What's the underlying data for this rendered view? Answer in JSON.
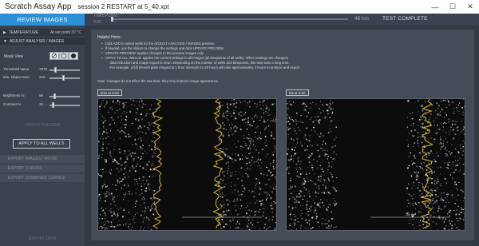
{
  "window": {
    "app_title": "Scratch Assay App",
    "session_title": "session 2 RESTART at 5_40.xpt",
    "minimize_glyph": "—",
    "maximize_glyph": "☐",
    "close_glyph": "✕"
  },
  "topbar": {
    "review_label": "REVIEW IMAGES",
    "timepoint_label": "TIMEPOINT",
    "timepoint_value": "0:00",
    "timepoint_end": "48 hrs",
    "status": "TEST COMPLETE",
    "timepoint_progress": 0
  },
  "sidebar": {
    "temperature_label": "TEMPERATURE",
    "temperature_status": "At set point 37 °C",
    "adjust_label": "ADJUST ANALYSIS / IMAGES",
    "mask_view_label": "Mask View",
    "mask_view_options": [
      "slash-icon",
      "ring-icon",
      "dot-icon"
    ],
    "sliders": [
      {
        "label": "Threshold Value",
        "value": "7078",
        "level": 0.18
      },
      {
        "label": "Min. Object Size",
        "value": "240",
        "level": 0.45
      },
      {
        "label": "Brightness %",
        "value": "56",
        "level": 0.16
      },
      {
        "label": "Contrast %",
        "value": "34",
        "level": 0.1
      }
    ],
    "update_preview_label": "UPDATE PREVIEW",
    "apply_all_label": "APPLY TO ALL WELLS",
    "export_images_label": "EXPORT IMAGES / MOVIE",
    "export_curves_label": "EXPORT CURVES",
    "export_combined_label": "EXPORT COMBINED CURVES",
    "export_data_label": "EXPORT DATA"
  },
  "main": {
    "hints_title": "Helpful Hints:",
    "bullet": "•",
    "hints": [
      "Click ADD to select wells for the ADJUST ANALYSIS / IMAGES preview.",
      "If needed, use the sliders to change the settings and click UPDATE PREVIEW.",
      "UPDATE PREVIEW: applies changes to the preview images only.",
      "APPLY TO ALL WELLS: applies the current settings to all images (all timepoints of all wells).  When settings are changed,",
      "data reduction and image export is rerun.  Depending on the number of wells and timepoints, this may take a long time.",
      "For example, a full 96-well plate imaged at 1 hour intervals for 48 hours will take approximately 3 hours to analyze and export."
    ],
    "hint_bullets": [
      true,
      true,
      true,
      true,
      false,
      false
    ],
    "note": "Note: Changes do not affect the raw data, they only improve image appearance.",
    "panels": [
      {
        "label": "B12 at 0:00",
        "scale": "100 µm"
      },
      {
        "label": "B3 at 0:00",
        "scale": "100 µm"
      }
    ]
  },
  "colors": {
    "accent": "#2d8fd5",
    "mask": "#d8b431",
    "background": "#343a44"
  }
}
